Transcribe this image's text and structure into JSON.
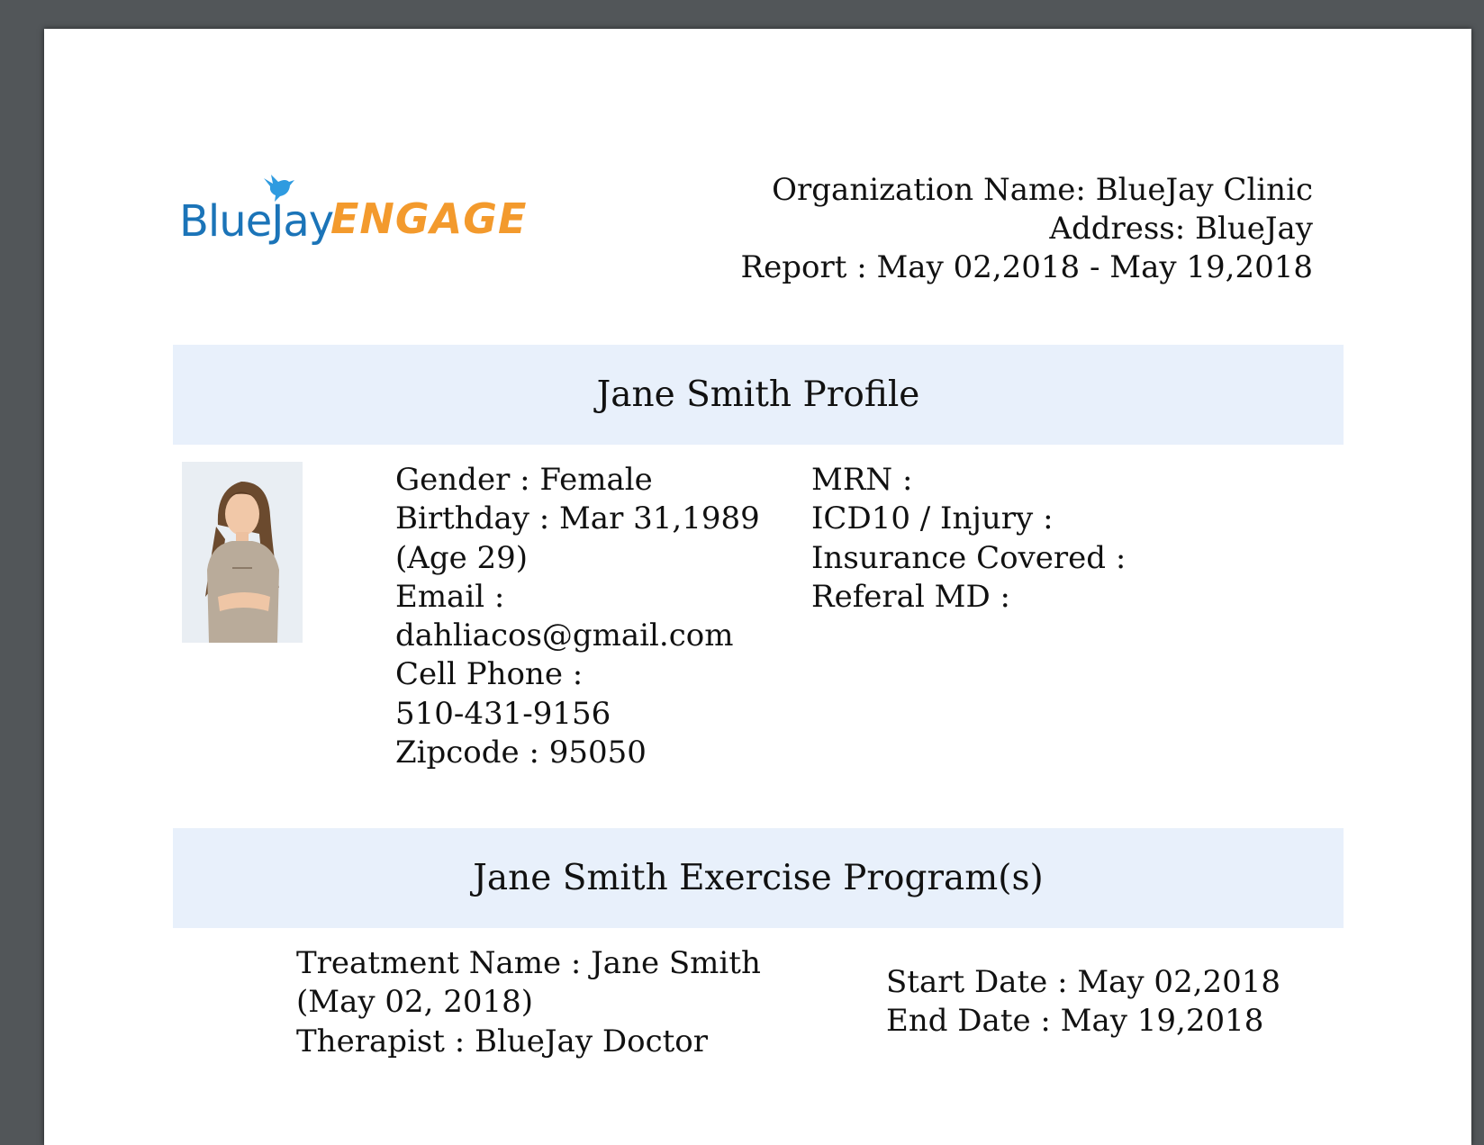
{
  "logo": {
    "part1": "BlueJay",
    "part2": "ENGAGE"
  },
  "header": {
    "organization": "Organization Name: BlueJay Clinic",
    "address": "Address: BlueJay",
    "report": "Report : May 02,2018 - May 19,2018"
  },
  "profile": {
    "title": "Jane Smith Profile",
    "left": [
      "Gender : Female",
      "Birthday : Mar 31,1989",
      "(Age 29)",
      "Email :",
      "dahliacos@gmail.com",
      "Cell Phone :",
      "510-431-9156",
      "Zipcode : 95050"
    ],
    "right": [
      "MRN :",
      "ICD10 / Injury :",
      "Insurance Covered :",
      "Referal MD :"
    ]
  },
  "program": {
    "title": "Jane Smith Exercise Program(s)",
    "left": [
      "Treatment Name : Jane Smith",
      "(May 02, 2018)",
      "Therapist : BlueJay Doctor"
    ],
    "right": [
      "Start Date : May 02,2018",
      "End Date : May 19,2018"
    ]
  },
  "colors": {
    "band": "#e8f0fb",
    "logo_blue": "#1b74b8",
    "logo_orange": "#f39a2d",
    "viewer_bg": "#525659"
  }
}
